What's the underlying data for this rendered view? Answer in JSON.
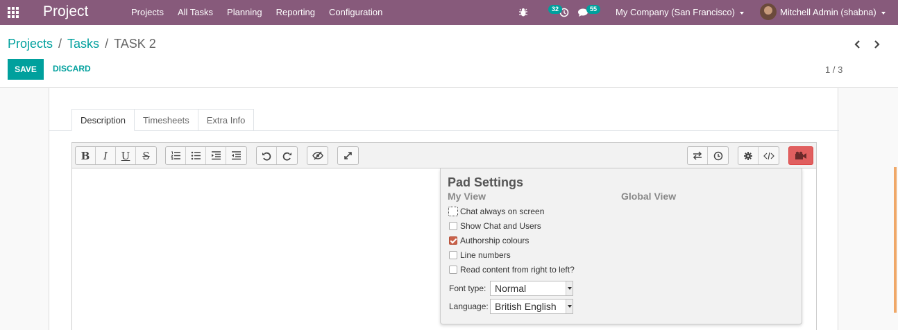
{
  "navbar": {
    "app_title": "Project",
    "menu": [
      "Projects",
      "All Tasks",
      "Planning",
      "Reporting",
      "Configuration"
    ],
    "activity_count": "32",
    "message_count": "55",
    "company": "My Company (San Francisco)",
    "user": "Mitchell Admin (shabna)",
    "color": "#875a7b"
  },
  "breadcrumb": {
    "projects": "Projects",
    "tasks": "Tasks",
    "current": "TASK 2",
    "separator": "/"
  },
  "buttons": {
    "save": "SAVE",
    "discard": "DISCARD"
  },
  "pager": {
    "label": "1 / 3"
  },
  "tabs": [
    "Description",
    "Timesheets",
    "Extra Info"
  ],
  "pad_settings": {
    "title": "Pad Settings",
    "my_view": "My View",
    "global_view": "Global View",
    "options": [
      {
        "label": "Chat always on screen",
        "checked": false
      },
      {
        "label": "Show Chat and Users",
        "checked": false
      },
      {
        "label": "Authorship colours",
        "checked": true
      },
      {
        "label": "Line numbers",
        "checked": false
      },
      {
        "label": "Read content from right to left?",
        "checked": false
      }
    ],
    "font_type_label": "Font type:",
    "font_type_value": "Normal",
    "language_label": "Language:",
    "language_value": "British English"
  },
  "colors": {
    "accent": "#00a09d",
    "checkbox_checked": "#c9614a"
  }
}
